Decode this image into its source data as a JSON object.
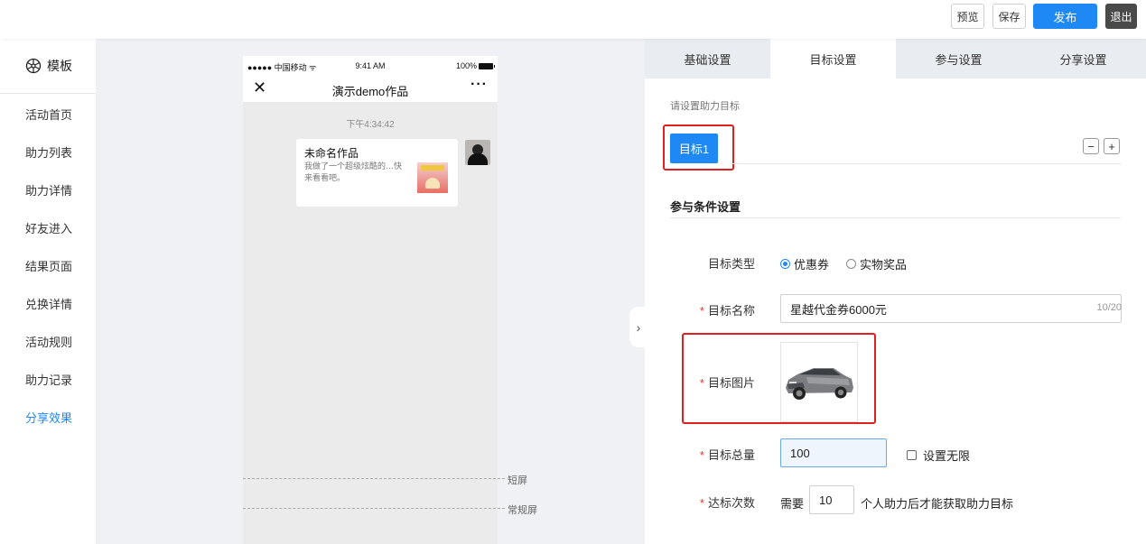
{
  "toolbar": {
    "preview_label": "预览",
    "save_label": "保存",
    "publish_label": "发布",
    "exit_label": "退出"
  },
  "sidebar": {
    "header": "模板",
    "items": [
      {
        "label": "活动首页"
      },
      {
        "label": "助力列表"
      },
      {
        "label": "助力详情"
      },
      {
        "label": "好友进入"
      },
      {
        "label": "结果页面"
      },
      {
        "label": "兑换详情"
      },
      {
        "label": "活动规则"
      },
      {
        "label": "助力记录"
      },
      {
        "label": "分享效果",
        "active": true
      }
    ]
  },
  "phone": {
    "status_left": "●●●●● 中国移动 ᯤ",
    "status_time": "9:41 AM",
    "status_battery": "100%",
    "nav_title": "演示demo作品",
    "message_time": "下午4:34:42",
    "card_title": "未命名作品",
    "card_desc": "我做了一个超级炫酷的…快来看看吧。"
  },
  "screen_markers": {
    "short": "短屏",
    "normal": "常规屏"
  },
  "tabs": [
    {
      "label": "基础设置"
    },
    {
      "label": "目标设置",
      "active": true
    },
    {
      "label": "参与设置"
    },
    {
      "label": "分享设置"
    }
  ],
  "form": {
    "hint": "请设置助力目标",
    "goal_tab": "目标1",
    "section_title": "参与条件设置",
    "target_type_label": "目标类型",
    "target_type_options": [
      "优惠券",
      "实物奖品"
    ],
    "target_type_selected": "优惠券",
    "target_name_label": "目标名称",
    "target_name_value": "星越代金券6000元",
    "target_name_counter": "10/20",
    "target_image_label": "目标图片",
    "target_total_label": "目标总量",
    "target_total_value": "100",
    "unlimited_label": "设置无限",
    "achieve_label": "达标次数",
    "achieve_prefix": "需要",
    "achieve_value": "10",
    "achieve_suffix": "个人助力后才能获取助力目标"
  },
  "colors": {
    "accent": "#1e88f5",
    "highlight_border": "#e02020",
    "required_mark": "#e53935"
  }
}
